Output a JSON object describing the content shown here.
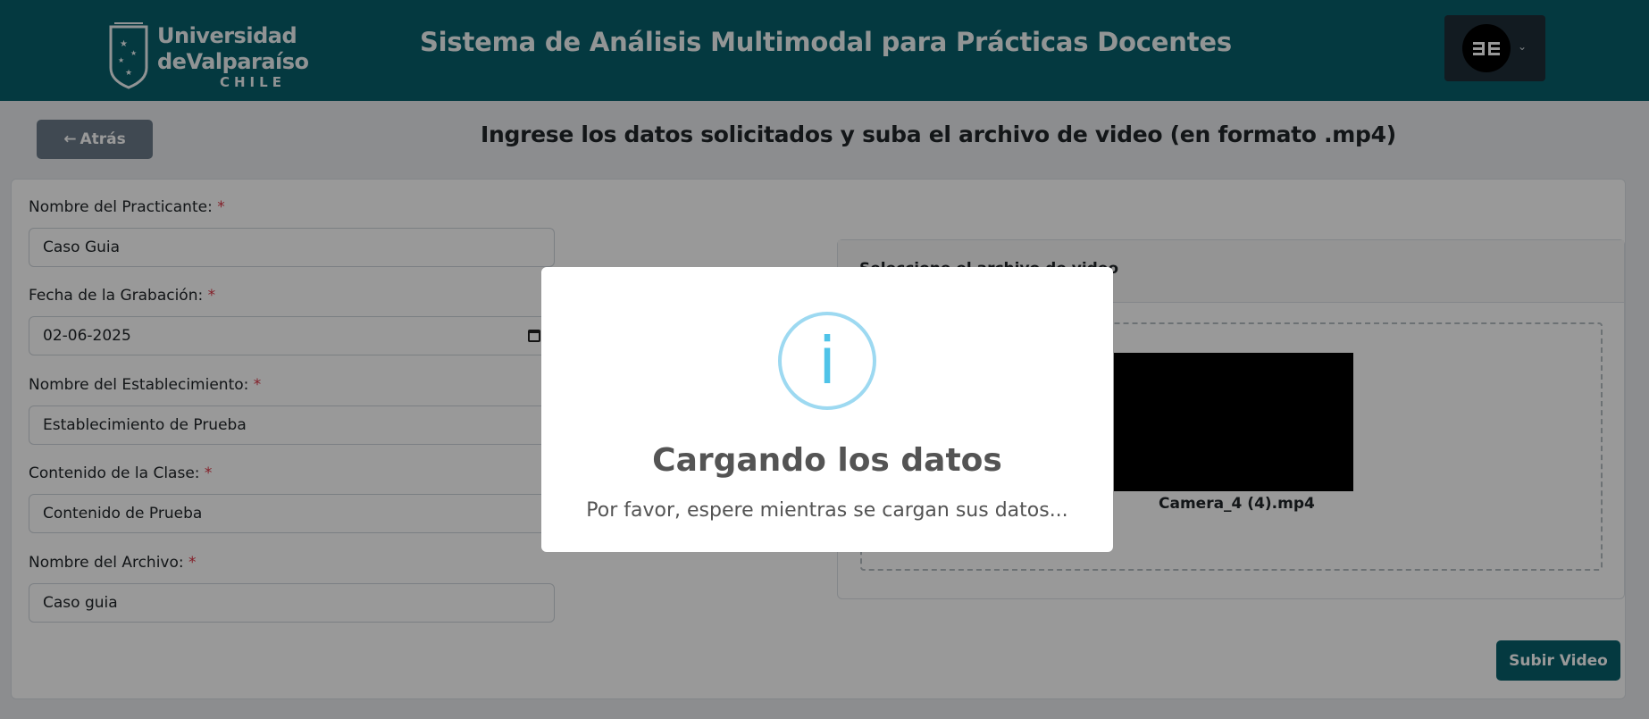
{
  "header": {
    "logo": {
      "line1": "Universidad",
      "line2": "deValparaíso",
      "line3": "CHILE"
    },
    "title": "Sistema de Análisis Multimodal para Prácticas Docentes",
    "user_menu": {
      "avatar_icon": "brand-logo-icon",
      "chevron_icon": "chevron-down-icon"
    }
  },
  "toolbar": {
    "back_label": "Atrás",
    "back_icon": "arrow-left-icon"
  },
  "page_title": "Ingrese los datos solicitados y suba el archivo de video (en formato .mp4)",
  "form": {
    "required_mark": "*",
    "fields": [
      {
        "label": "Nombre del Practicante:",
        "value": "Caso Guia"
      },
      {
        "label": "Fecha de la Grabación:",
        "value": "02-06-2025"
      },
      {
        "label": "Nombre del Establecimiento:",
        "value": "Establecimiento de Prueba"
      },
      {
        "label": "Contenido de la Clase:",
        "value": "Contenido de Prueba"
      },
      {
        "label": "Nombre del Archivo:",
        "value": "Caso guia"
      }
    ]
  },
  "upload": {
    "card_title": "Seleccione el archivo de video",
    "file_name": "Camera_4 (4).mp4"
  },
  "submit_label": "Subir Video",
  "modal": {
    "icon": "info-icon",
    "glyph": "i",
    "title": "Cargando los datos",
    "message": "Por favor, espere mientras se cargan sus datos..."
  },
  "colors": {
    "brand": "#075f6b",
    "required": "#dc3545",
    "info": "#4fc3e8"
  }
}
